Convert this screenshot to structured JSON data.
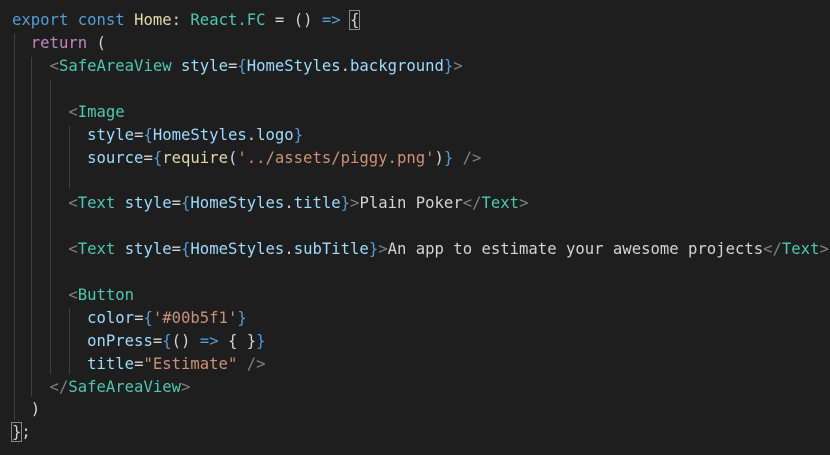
{
  "colors": {
    "background": "#1e1e1e",
    "keyword": "#569cd6",
    "control_keyword": "#c586c0",
    "tag": "#4ec9b0",
    "attribute": "#9cdcfe",
    "string": "#ce9178",
    "function": "#dcdcaa",
    "text": "#d4d4d4",
    "tag_bracket": "#808080"
  },
  "lines": [
    {
      "t0": "export",
      "t1": " ",
      "t2": "const",
      "t3": " ",
      "t4": "Home",
      "t5": ": ",
      "t6": "React.FC",
      "t7": " = () ",
      "t8": "=>",
      "t9": " ",
      "t10": "{"
    },
    {
      "t0": "  ",
      "t1": "return",
      "t2": " ("
    },
    {
      "t0": "    ",
      "t1": "<",
      "t2": "SafeAreaView",
      "t3": " ",
      "t4": "style",
      "t5": "=",
      "t6": "{",
      "t7": "HomeStyles",
      "t8": ".",
      "t9": "background",
      "t10": "}",
      "t11": ">"
    },
    {},
    {
      "t0": "      ",
      "t1": "<",
      "t2": "Image"
    },
    {
      "t0": "        ",
      "t1": "style",
      "t2": "=",
      "t3": "{",
      "t4": "HomeStyles",
      "t5": ".",
      "t6": "logo",
      "t7": "}"
    },
    {
      "t0": "        ",
      "t1": "source",
      "t2": "=",
      "t3": "{",
      "t4": "require",
      "t5": "(",
      "t6": "'../assets/piggy.png'",
      "t7": ")",
      "t8": "}",
      "t9": " ",
      "t10": "/>"
    },
    {},
    {
      "t0": "      ",
      "t1": "<",
      "t2": "Text",
      "t3": " ",
      "t4": "style",
      "t5": "=",
      "t6": "{",
      "t7": "HomeStyles",
      "t8": ".",
      "t9": "title",
      "t10": "}",
      "t11": ">",
      "t12": "Plain Poker",
      "t13": "</",
      "t14": "Text",
      "t15": ">"
    },
    {},
    {
      "t0": "      ",
      "t1": "<",
      "t2": "Text",
      "t3": " ",
      "t4": "style",
      "t5": "=",
      "t6": "{",
      "t7": "HomeStyles",
      "t8": ".",
      "t9": "subTitle",
      "t10": "}",
      "t11": ">",
      "t12": "An app to estimate your awesome projects",
      "t13": "</",
      "t14": "Text",
      "t15": ">"
    },
    {},
    {
      "t0": "      ",
      "t1": "<",
      "t2": "Button"
    },
    {
      "t0": "        ",
      "t1": "color",
      "t2": "=",
      "t3": "{",
      "t4": "'#00b5f1'",
      "t5": "}"
    },
    {
      "t0": "        ",
      "t1": "onPress",
      "t2": "=",
      "t3": "{",
      "t4": "() ",
      "t5": "=>",
      "t6": " { }",
      "t7": "}"
    },
    {
      "t0": "        ",
      "t1": "title",
      "t2": "=",
      "t3": "\"Estimate\"",
      "t4": " ",
      "t5": "/>"
    },
    {
      "t0": "    ",
      "t1": "</",
      "t2": "SafeAreaView",
      "t3": ">"
    },
    {
      "t0": "  )"
    },
    {
      "t0": "}",
      "t1": ";"
    }
  ]
}
